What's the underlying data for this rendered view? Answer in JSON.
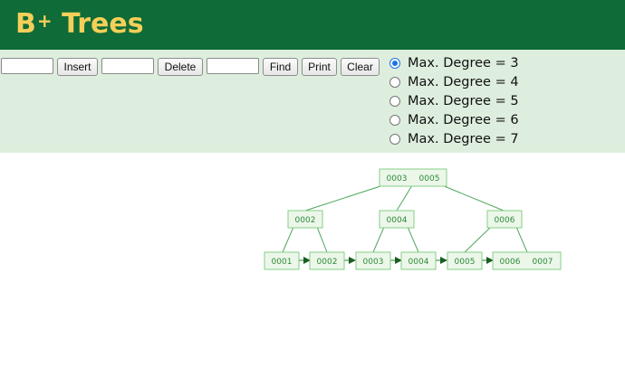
{
  "header": {
    "title": "B",
    "title_sup": "+",
    "title_rest": " Trees"
  },
  "controls": {
    "insert_value": "",
    "insert_label": "Insert",
    "delete_value": "",
    "delete_label": "Delete",
    "find_value": "",
    "find_label": "Find",
    "print_label": "Print",
    "clear_label": "Clear"
  },
  "degree_options": [
    {
      "label": "Max. Degree = 3",
      "selected": true
    },
    {
      "label": "Max. Degree = 4",
      "selected": false
    },
    {
      "label": "Max. Degree = 5",
      "selected": false
    },
    {
      "label": "Max. Degree = 6",
      "selected": false
    },
    {
      "label": "Max. Degree = 7",
      "selected": false
    }
  ],
  "tree": {
    "root": [
      "0003",
      "0005"
    ],
    "internal": [
      [
        "0002"
      ],
      [
        "0004"
      ],
      [
        "0006"
      ]
    ],
    "leaves": [
      [
        "0001"
      ],
      [
        "0002"
      ],
      [
        "0003"
      ],
      [
        "0004"
      ],
      [
        "0005"
      ],
      [
        "0006",
        "0007"
      ]
    ]
  },
  "colors": {
    "header_bg": "#0f6b37",
    "title": "#f4cf59",
    "controls_bg": "#deeede",
    "node_fill": "#ecf7ea",
    "node_stroke": "#86cf86",
    "key_text": "#2c8a36"
  }
}
